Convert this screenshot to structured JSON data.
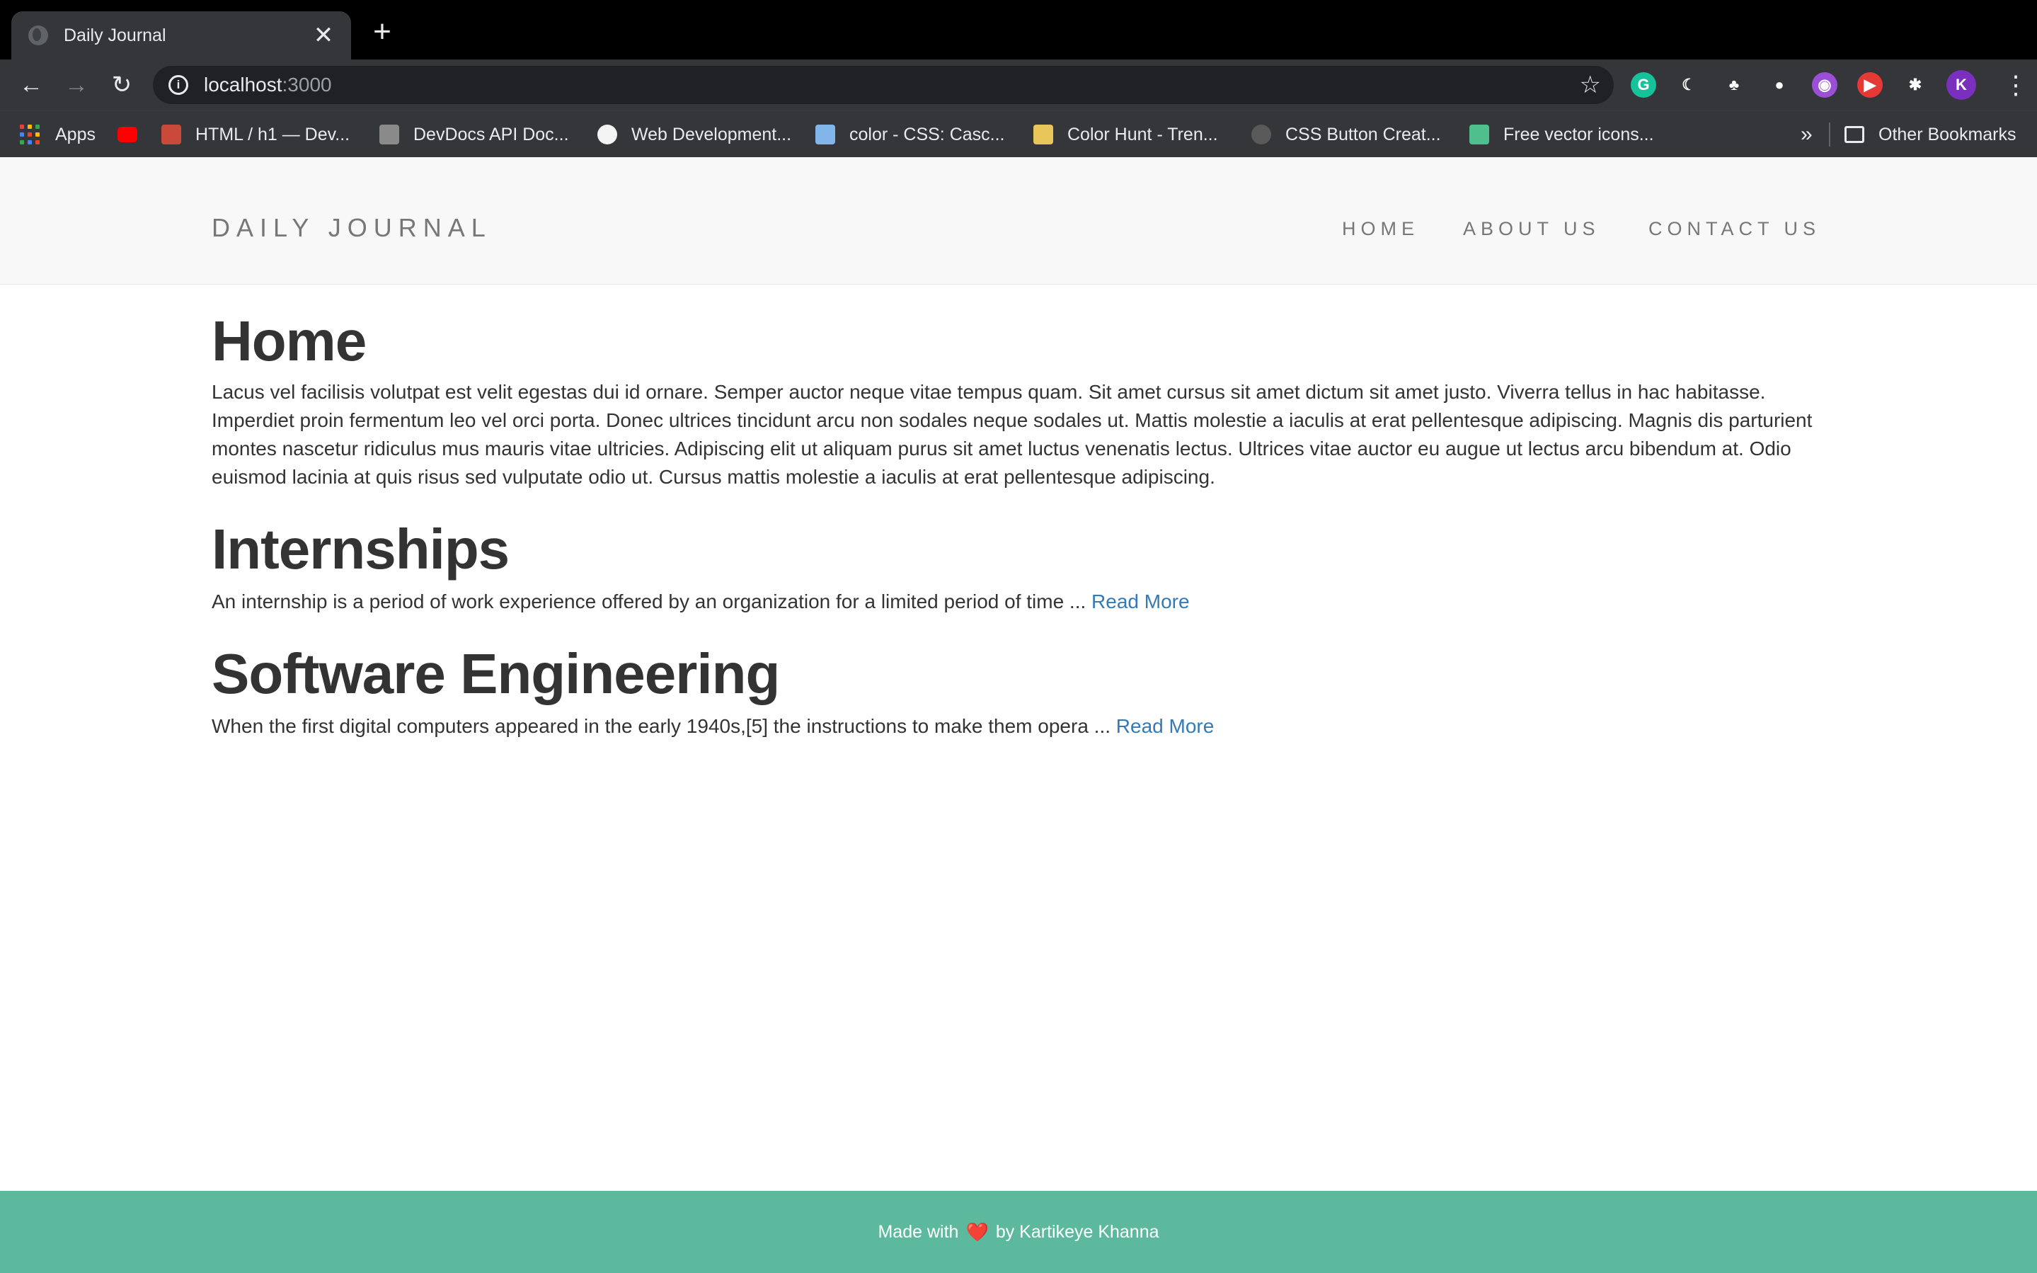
{
  "browser": {
    "tab": {
      "title": "Daily Journal",
      "close_glyph": "✕"
    },
    "new_tab_glyph": "+",
    "toolbar": {
      "back_glyph": "←",
      "forward_glyph": "→",
      "reload_glyph": "↻",
      "url_host": "localhost",
      "url_port": ":3000",
      "star_glyph": "☆",
      "profile_initial": "K",
      "menu_glyph": "⋮"
    },
    "extensions": [
      {
        "name": "grammarly-extension-icon",
        "letter": "G",
        "color": "#15c39a"
      },
      {
        "name": "dark-mode-extension-icon",
        "letter": "☾",
        "color": "#35363a"
      },
      {
        "name": "tree-extension-icon",
        "letter": "♣",
        "color": "#35363a"
      },
      {
        "name": "grey-extension-icon",
        "letter": "●",
        "color": "#35363a"
      },
      {
        "name": "purple-extension-icon",
        "letter": "◉",
        "color": "#9b4fd6"
      },
      {
        "name": "video-extension-icon",
        "letter": "▶",
        "color": "#e53935"
      },
      {
        "name": "puzzle-extension-icon",
        "letter": "✱",
        "color": "#35363a"
      }
    ],
    "bookmarks": [
      {
        "label": "Apps",
        "icon": "apps-grid-icon"
      },
      {
        "label": "",
        "icon": "youtube-icon",
        "color": "#ff0000"
      },
      {
        "label": "HTML / h1 — Dev...",
        "icon": "mdn-icon",
        "color": "#c94a3a"
      },
      {
        "label": "DevDocs API Doc...",
        "icon": "devdocs-icon",
        "color": "#8a8a8a"
      },
      {
        "label": "Web Development...",
        "icon": "web-dev-icon",
        "color": "#f4f4f4"
      },
      {
        "label": "color - CSS: Casc...",
        "icon": "mdn-css-icon",
        "color": "#83b6e8"
      },
      {
        "label": "Color Hunt - Tren...",
        "icon": "color-hunt-icon",
        "color": "#e9c65a"
      },
      {
        "label": "CSS Button Creat...",
        "icon": "gear-icon",
        "color": "#5a5a5a"
      },
      {
        "label": "Free vector icons...",
        "icon": "flaticon-icon",
        "color": "#4fc08d"
      }
    ],
    "overflow_glyph": "»",
    "other_bookmarks": "Other Bookmarks"
  },
  "site": {
    "brand": "DAILY JOURNAL",
    "nav": [
      "HOME",
      "ABOUT US",
      "CONTACT US"
    ],
    "home": {
      "title": "Home",
      "body": "Lacus vel facilisis volutpat est velit egestas dui id ornare. Semper auctor neque vitae tempus quam. Sit amet cursus sit amet dictum sit amet justo. Viverra tellus in hac habitasse. Imperdiet proin fermentum leo vel orci porta. Donec ultrices tincidunt arcu non sodales neque sodales ut. Mattis molestie a iaculis at erat pellentesque adipiscing. Magnis dis parturient montes nascetur ridiculus mus mauris vitae ultricies. Adipiscing elit ut aliquam purus sit amet luctus venenatis lectus. Ultrices vitae auctor eu augue ut lectus arcu bibendum at. Odio euismod lacinia at quis risus sed vulputate odio ut. Cursus mattis molestie a iaculis at erat pellentesque adipiscing."
    },
    "posts": [
      {
        "title": "Internships",
        "excerpt": "An internship is a period of work experience offered by an organization for a limited period of time ... ",
        "link": "Read More"
      },
      {
        "title": "Software Engineering",
        "excerpt": "When the first digital computers appeared in the early 1940s,[5] the instructions to make them opera ... ",
        "link": "Read More"
      }
    ],
    "footer": {
      "prefix": "Made with",
      "heart": "❤️",
      "suffix": "by Kartikeye Khanna"
    }
  }
}
